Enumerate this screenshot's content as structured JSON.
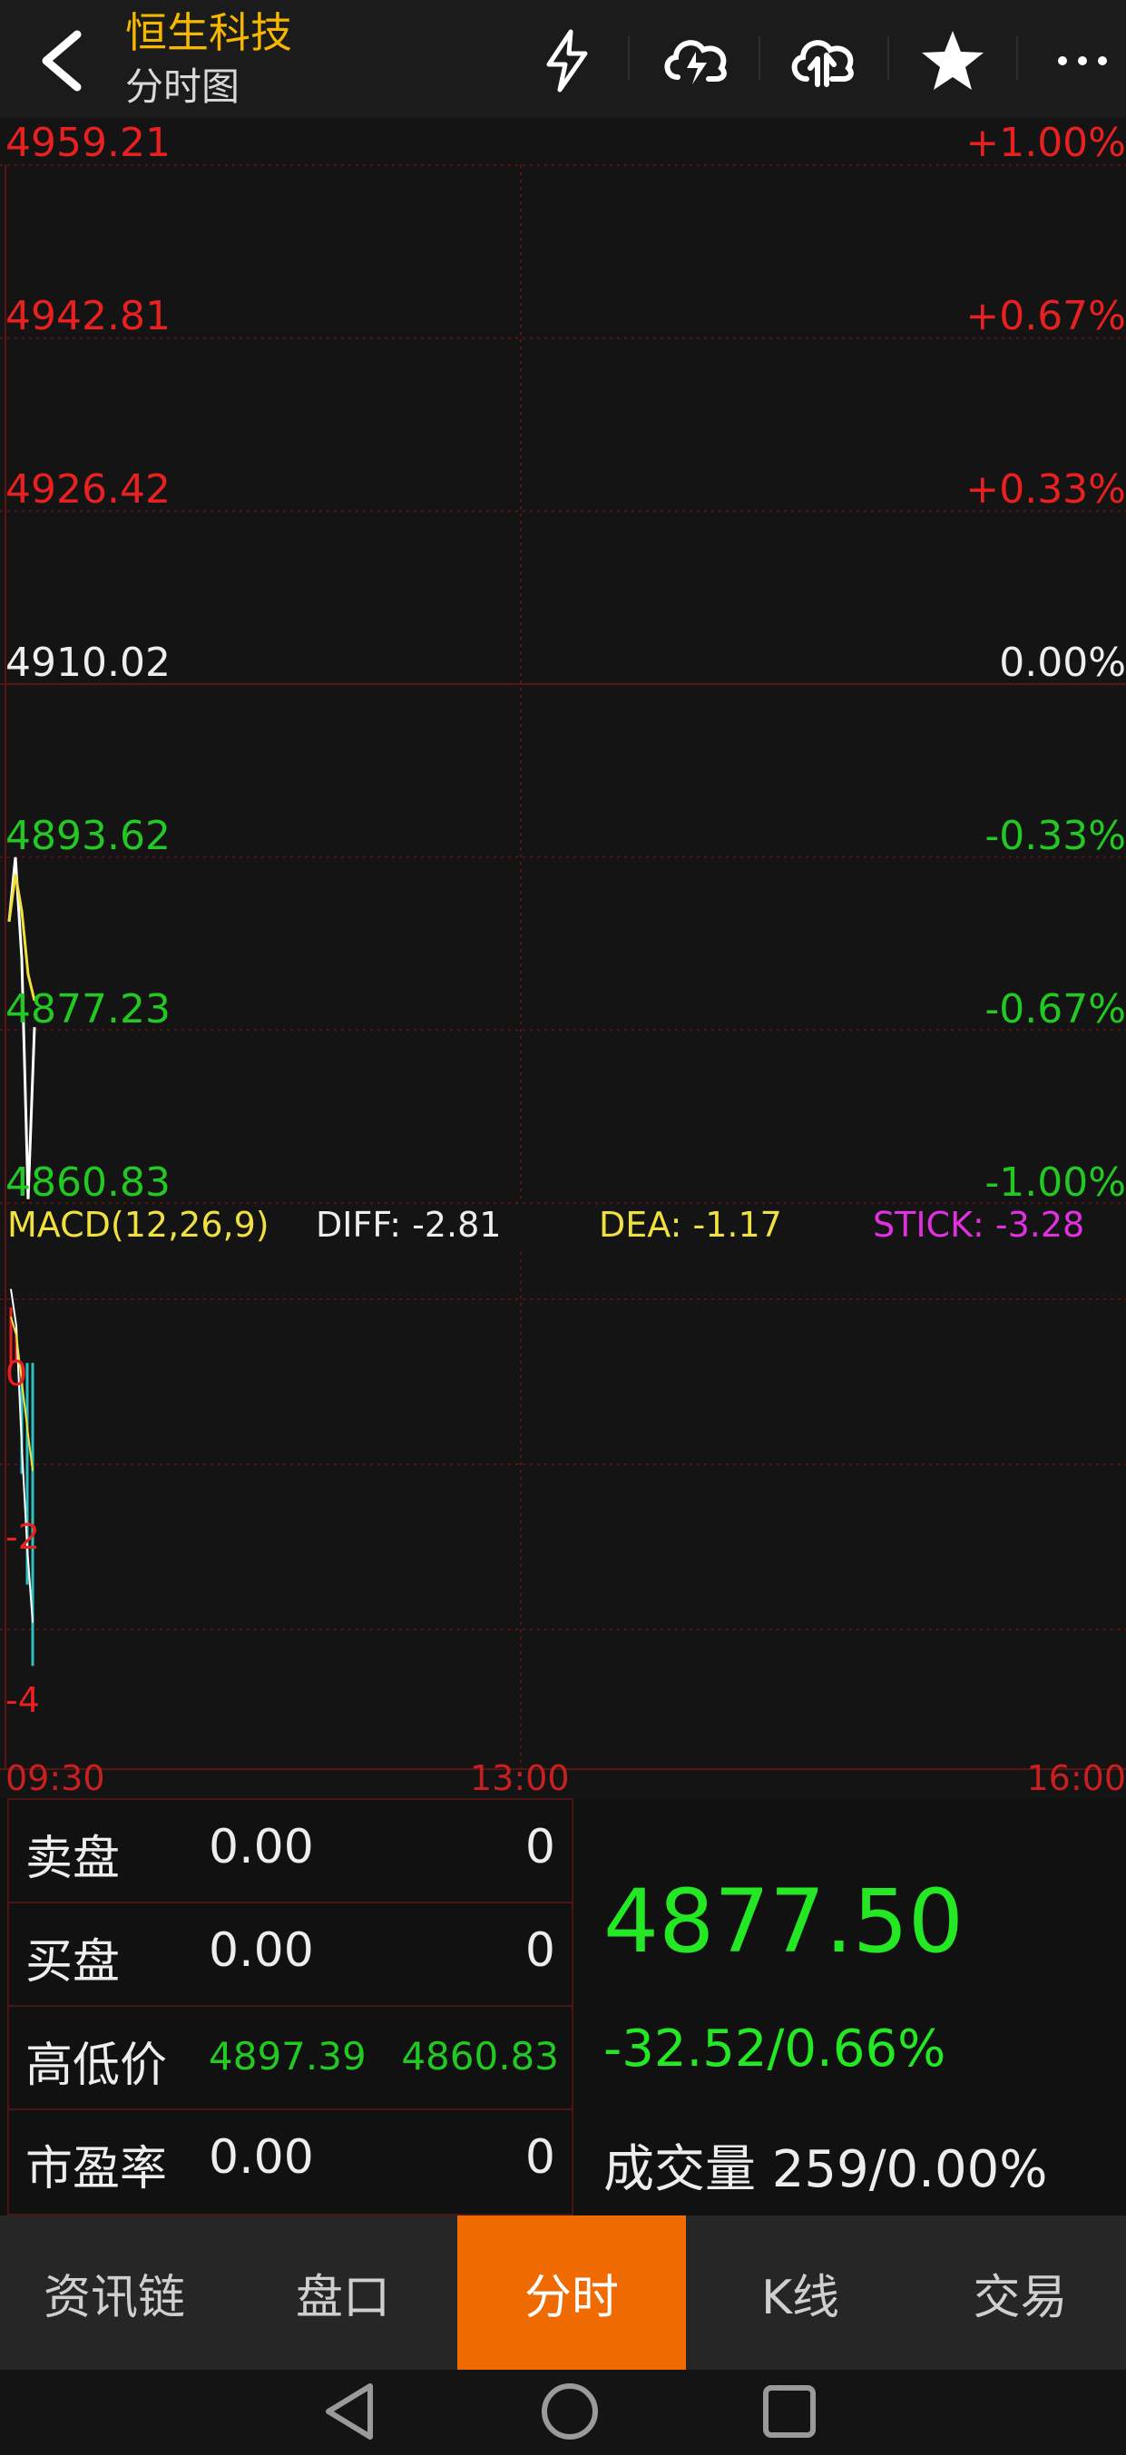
{
  "header": {
    "title": "恒生科技",
    "subtitle": "分时图"
  },
  "chart": {
    "price_labels_left": [
      "4959.21",
      "4942.81",
      "4926.42",
      "4910.02",
      "4893.62",
      "4877.23",
      "4860.83"
    ],
    "pct_labels_right": [
      "+1.00%",
      "+0.67%",
      "+0.33%",
      "0.00%",
      "-0.33%",
      "-0.67%",
      "-1.00%"
    ],
    "macd": {
      "name": "MACD(12,26,9)",
      "diff": "DIFF: -2.81",
      "dea": "DEA: -1.17",
      "stick": "STICK: -3.28",
      "axis_labels": [
        "0",
        "-2",
        "-4"
      ]
    },
    "time_labels": [
      "09:30",
      "13:00",
      "16:00"
    ]
  },
  "chart_data": {
    "type": "line",
    "x": [
      "09:30",
      "09:31",
      "09:32",
      "09:33",
      "09:34"
    ],
    "series": [
      {
        "name": "",
        "values": [
          4887.5,
          4893.6,
          4884.0,
          4861.2,
          4877.5
        ]
      },
      {
        "name": "",
        "values": [
          4887.5,
          4892.0,
          4888.5,
          4882.5,
          4880.0
        ]
      }
    ],
    "ylim": [
      4860.83,
      4959.21
    ],
    "xlabel": "",
    "ylabel": "",
    "grid": true,
    "macd_panel": {
      "ylim": [
        -4.2,
        1.2
      ],
      "diff_last": -2.81,
      "dea_last": -1.17,
      "stick_last": -3.28
    }
  },
  "info": {
    "rows": [
      {
        "label": "卖盘",
        "v1": "0.00",
        "v2": "0"
      },
      {
        "label": "买盘",
        "v1": "0.00",
        "v2": "0"
      },
      {
        "label": "高低价",
        "v1": "4897.39",
        "v2": "4860.83"
      },
      {
        "label": "市盈率",
        "v1": "0.00",
        "v2": "0"
      }
    ],
    "price": "4877.50",
    "change": "-32.52/0.66%",
    "volume": "成交量 259/0.00%"
  },
  "tabs": [
    "资讯链",
    "盘口",
    "分时",
    "K线",
    "交易"
  ],
  "active_tab": "分时",
  "colors": {
    "up": "#e82020",
    "down": "#23c823",
    "neutral": "#eeeeee",
    "accent": "#f5b700",
    "active_tab": "#ef6a00",
    "macd_name": "#f0e040",
    "stick": "#e030e0"
  },
  "icons": [
    "back-arrow-icon",
    "lightning-icon",
    "cloud-download-icon",
    "cloud-upload-icon",
    "star-icon",
    "more-icon"
  ]
}
